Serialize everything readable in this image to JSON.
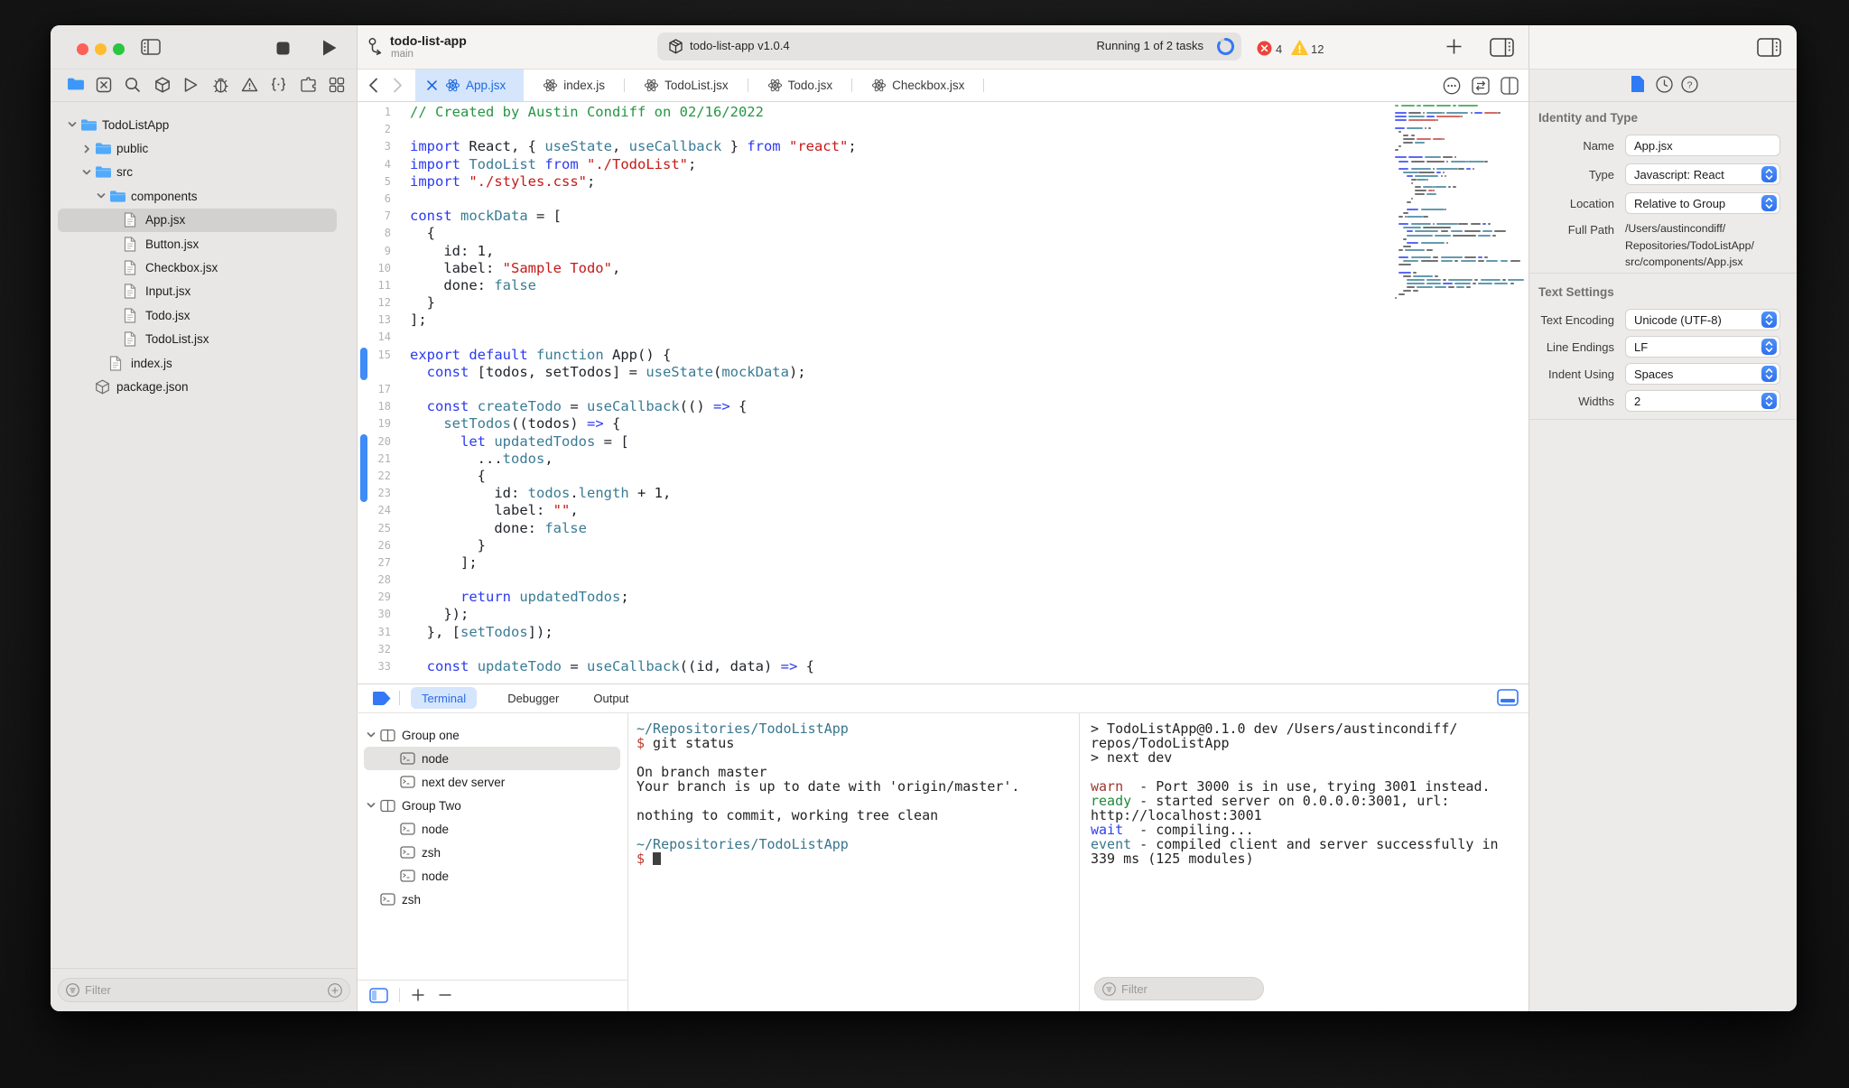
{
  "window": {
    "project": "todo-list-app",
    "branch": "main"
  },
  "toolbar": {
    "status_app": "todo-list-app v1.0.4",
    "status_running": "Running 1 of 2 tasks",
    "error_count": "4",
    "warning_count": "12"
  },
  "navigator_icons": [
    "project-folder-icon",
    "source-control-icon",
    "search-icon",
    "package-icon",
    "run-icon",
    "bug-icon",
    "issues-icon",
    "symbols-icon",
    "extensions-icon",
    "grid-icon"
  ],
  "sidebar": {
    "tree": [
      {
        "label": "TodoListApp",
        "type": "folder",
        "level": 0,
        "chevron": "down"
      },
      {
        "label": "public",
        "type": "folder",
        "level": 1,
        "chevron": "right"
      },
      {
        "label": "src",
        "type": "folder",
        "level": 1,
        "chevron": "down"
      },
      {
        "label": "components",
        "type": "folder",
        "level": 2,
        "chevron": "down"
      },
      {
        "label": "App.jsx",
        "type": "file",
        "level": 3,
        "selected": true
      },
      {
        "label": "Button.jsx",
        "type": "file",
        "level": 3
      },
      {
        "label": "Checkbox.jsx",
        "type": "file",
        "level": 3
      },
      {
        "label": "Input.jsx",
        "type": "file",
        "level": 3
      },
      {
        "label": "Todo.jsx",
        "type": "file",
        "level": 3
      },
      {
        "label": "TodoList.jsx",
        "type": "file",
        "level": 3
      },
      {
        "label": "index.js",
        "type": "file",
        "level": 2
      },
      {
        "label": "package.json",
        "type": "package",
        "level": 1
      }
    ],
    "filter_placeholder": "Filter"
  },
  "editor": {
    "tabs": [
      {
        "label": "App.jsx",
        "active": true
      },
      {
        "label": "index.js"
      },
      {
        "label": "TodoList.jsx"
      },
      {
        "label": "Todo.jsx"
      },
      {
        "label": "Checkbox.jsx"
      }
    ],
    "hidden_line_numbers": [
      16
    ],
    "change_bars": [
      [
        15,
        16
      ],
      [
        20,
        23
      ]
    ],
    "lines": [
      [
        [
          "c",
          "// Created by Austin Condiff on 02/16/2022"
        ]
      ],
      [],
      [
        [
          "k",
          "import"
        ],
        [
          "p",
          " React, { "
        ],
        [
          "i",
          "useState"
        ],
        [
          "p",
          ", "
        ],
        [
          "i",
          "useCallback"
        ],
        [
          "p",
          " } "
        ],
        [
          "k",
          "from"
        ],
        [
          "p",
          " "
        ],
        [
          "s",
          "\"react\""
        ],
        [
          "p",
          ";"
        ]
      ],
      [
        [
          "k",
          "import"
        ],
        [
          "p",
          " "
        ],
        [
          "i",
          "TodoList"
        ],
        [
          "p",
          " "
        ],
        [
          "k",
          "from"
        ],
        [
          "p",
          " "
        ],
        [
          "s",
          "\"./TodoList\""
        ],
        [
          "p",
          ";"
        ]
      ],
      [
        [
          "k",
          "import"
        ],
        [
          "p",
          " "
        ],
        [
          "s",
          "\"./styles.css\""
        ],
        [
          "p",
          ";"
        ]
      ],
      [],
      [
        [
          "k",
          "const"
        ],
        [
          "p",
          " "
        ],
        [
          "i",
          "mockData"
        ],
        [
          "p",
          " = ["
        ]
      ],
      [
        [
          "p",
          "  {"
        ]
      ],
      [
        [
          "p",
          "    id: 1,"
        ]
      ],
      [
        [
          "p",
          "    label: "
        ],
        [
          "s",
          "\"Sample Todo\""
        ],
        [
          "p",
          ","
        ]
      ],
      [
        [
          "p",
          "    done: "
        ],
        [
          "i",
          "false"
        ]
      ],
      [
        [
          "p",
          "  }"
        ]
      ],
      [
        [
          "p",
          "];"
        ]
      ],
      [],
      [
        [
          "k",
          "export"
        ],
        [
          "p",
          " "
        ],
        [
          "k",
          "default"
        ],
        [
          "p",
          " "
        ],
        [
          "i",
          "function"
        ],
        [
          "p",
          " App() {"
        ]
      ],
      [
        [
          "p",
          "  "
        ],
        [
          "k",
          "const"
        ],
        [
          "p",
          " [todos, setTodos] = "
        ],
        [
          "i",
          "useState"
        ],
        [
          "p",
          "("
        ],
        [
          "i",
          "mockData"
        ],
        [
          "p",
          ");"
        ]
      ],
      [],
      [
        [
          "p",
          "  "
        ],
        [
          "k",
          "const"
        ],
        [
          "p",
          " "
        ],
        [
          "i",
          "createTodo"
        ],
        [
          "p",
          " = "
        ],
        [
          "i",
          "useCallback"
        ],
        [
          "p",
          "(() "
        ],
        [
          "k",
          "=>"
        ],
        [
          "p",
          " {"
        ]
      ],
      [
        [
          "p",
          "    "
        ],
        [
          "i",
          "setTodos"
        ],
        [
          "p",
          "((todos) "
        ],
        [
          "k",
          "=>"
        ],
        [
          "p",
          " {"
        ]
      ],
      [
        [
          "p",
          "      "
        ],
        [
          "k",
          "let"
        ],
        [
          "p",
          " "
        ],
        [
          "i",
          "updatedTodos"
        ],
        [
          "p",
          " = ["
        ]
      ],
      [
        [
          "p",
          "        ..."
        ],
        [
          "i",
          "todos"
        ],
        [
          "p",
          ","
        ]
      ],
      [
        [
          "p",
          "        {"
        ]
      ],
      [
        [
          "p",
          "          id: "
        ],
        [
          "i",
          "todos"
        ],
        [
          "p",
          "."
        ],
        [
          "i",
          "length"
        ],
        [
          "p",
          " + 1,"
        ]
      ],
      [
        [
          "p",
          "          label: "
        ],
        [
          "s",
          "\"\""
        ],
        [
          "p",
          ","
        ]
      ],
      [
        [
          "p",
          "          done: "
        ],
        [
          "i",
          "false"
        ]
      ],
      [
        [
          "p",
          "        }"
        ]
      ],
      [
        [
          "p",
          "      ];"
        ]
      ],
      [],
      [
        [
          "p",
          "      "
        ],
        [
          "k",
          "return"
        ],
        [
          "p",
          " "
        ],
        [
          "i",
          "updatedTodos"
        ],
        [
          "p",
          ";"
        ]
      ],
      [
        [
          "p",
          "    });"
        ]
      ],
      [
        [
          "p",
          "  }, ["
        ],
        [
          "i",
          "setTodos"
        ],
        [
          "p",
          "]);"
        ]
      ],
      [],
      [
        [
          "p",
          "  "
        ],
        [
          "k",
          "const"
        ],
        [
          "p",
          " "
        ],
        [
          "i",
          "updateTodo"
        ],
        [
          "p",
          " = "
        ],
        [
          "i",
          "useCallback"
        ],
        [
          "p",
          "((id, data) "
        ],
        [
          "k",
          "=>"
        ],
        [
          "p",
          " {"
        ]
      ]
    ]
  },
  "inspector": {
    "section1": "Identity and Type",
    "name_label": "Name",
    "name_value": "App.jsx",
    "type_label": "Type",
    "type_value": "Javascript: React",
    "location_label": "Location",
    "location_value": "Relative to Group",
    "fullpath_label": "Full Path",
    "fullpath_lines": [
      "/Users/austincondiff/",
      "Repositories/TodoListApp/",
      "src/components/App.jsx"
    ],
    "section2": "Text Settings",
    "encoding_label": "Text Encoding",
    "encoding_value": "Unicode (UTF-8)",
    "lineendings_label": "Line Endings",
    "lineendings_value": "LF",
    "indent_label": "Indent Using",
    "indent_value": "Spaces",
    "widths_label": "Widths",
    "widths_value": "2"
  },
  "bottom": {
    "tabs": [
      {
        "label": "Terminal",
        "active": true
      },
      {
        "label": "Debugger"
      },
      {
        "label": "Output"
      }
    ],
    "groups": [
      {
        "label": "Group one",
        "type": "group",
        "level": 0
      },
      {
        "label": "node",
        "type": "terminal",
        "level": 1,
        "selected": true
      },
      {
        "label": "next dev server",
        "type": "terminal",
        "level": 1
      },
      {
        "label": "Group Two",
        "type": "group",
        "level": 0
      },
      {
        "label": "node",
        "type": "terminal",
        "level": 1
      },
      {
        "label": "zsh",
        "type": "terminal",
        "level": 1
      },
      {
        "label": "node",
        "type": "terminal",
        "level": 1
      },
      {
        "label": "zsh",
        "type": "terminal",
        "level": 0
      }
    ],
    "terminal_left": [
      [
        [
          "path",
          "~/Repositories/TodoListApp"
        ]
      ],
      [
        [
          "dollar",
          "$"
        ],
        [
          "plain",
          " git status"
        ]
      ],
      [],
      [
        [
          "plain",
          "On branch master"
        ]
      ],
      [
        [
          "plain",
          "Your branch is up to date with 'origin/master'."
        ]
      ],
      [],
      [
        [
          "plain",
          "nothing to commit, working tree clean"
        ]
      ],
      [],
      [
        [
          "path",
          "~/Repositories/TodoListApp"
        ]
      ],
      [
        [
          "dollar",
          "$"
        ],
        [
          "plain",
          " "
        ],
        [
          "cursor",
          ""
        ]
      ]
    ],
    "terminal_right": [
      [
        [
          "plain",
          "> TodoListApp@0.1.0 dev /Users/austincondiff/"
        ]
      ],
      [
        [
          "plain",
          "repos/TodoListApp"
        ]
      ],
      [
        [
          "plain",
          "> next dev"
        ]
      ],
      [],
      [
        [
          "warn",
          "warn"
        ],
        [
          "plain",
          "  - Port 3000 is in use, trying 3001 instead."
        ]
      ],
      [
        [
          "ready",
          "ready"
        ],
        [
          "plain",
          " - started server on 0.0.0.0:3001, url:"
        ]
      ],
      [
        [
          "plain",
          "http://localhost:3001"
        ]
      ],
      [
        [
          "wait",
          "wait"
        ],
        [
          "plain",
          "  - compiling..."
        ]
      ],
      [
        [
          "event",
          "event"
        ],
        [
          "plain",
          " - compiled client and server successfully in"
        ]
      ],
      [
        [
          "plain",
          "339 ms (125 modules)"
        ]
      ]
    ],
    "filter_placeholder": "Filter"
  }
}
